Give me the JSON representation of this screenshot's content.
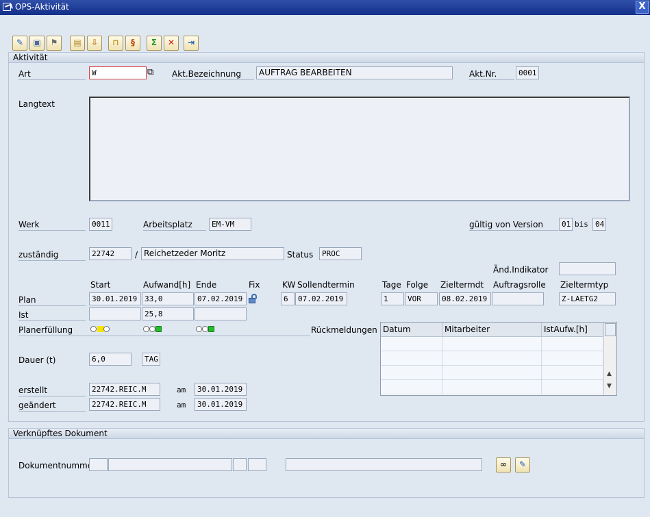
{
  "window": {
    "title": "OPS-Aktivität",
    "close_glyph": "X"
  },
  "toolbar": [
    {
      "name": "edit-pencil-icon",
      "glyph": "✎",
      "color": "#1f5fc4"
    },
    {
      "name": "save-icon",
      "glyph": "▣",
      "color": "#4a6aa0"
    },
    {
      "name": "flag-icon",
      "glyph": "⚑",
      "color": "#6a6a6a"
    },
    {
      "name": "clipboard-icon",
      "glyph": "▤",
      "color": "#b08a2a"
    },
    {
      "name": "download-icon",
      "glyph": "⇩",
      "color": "#c08020"
    },
    {
      "name": "lock-icon",
      "glyph": "⊓",
      "color": "#c09a20"
    },
    {
      "name": "scroll-icon",
      "glyph": "§",
      "color": "#c04a10"
    },
    {
      "name": "sum-icon",
      "glyph": "Σ",
      "color": "#2a9a2a"
    },
    {
      "name": "delete-icon",
      "glyph": "✕",
      "color": "#d02020"
    },
    {
      "name": "export-icon",
      "glyph": "⇥",
      "color": "#2a60b0"
    }
  ],
  "aktivitaet": {
    "frame_title": "Aktivität",
    "art_label": "Art",
    "art_value": "W",
    "copy_glyph": "⧉",
    "bez_label": "Akt.Bezeichnung",
    "bez_value": "AUFTRAG BEARBEITEN",
    "nr_label": "Akt.Nr.",
    "nr_value": "0001",
    "langtext_label": "Langtext",
    "werk_label": "Werk",
    "werk_value": "0011",
    "arbeitsplatz_label": "Arbeitsplatz",
    "arbeitsplatz_value": "EM-VM",
    "version_label": "gültig von Version",
    "version_from": "01",
    "bis_label": "bis",
    "version_to": "04",
    "zustaendig_label": "zuständig",
    "zustaendig_value": "22742",
    "slash": "/",
    "zustaendig_name": "Reichetzeder Moritz",
    "status_label": "Status",
    "status_value": "PROC",
    "aend_label": "Änd.Indikator",
    "aend_value": "",
    "headers": {
      "start": "Start",
      "aufwand": "Aufwand[h]",
      "ende": "Ende",
      "fix": "Fix",
      "kw": "KW",
      "sollend": "Sollendtermin",
      "tage": "Tage",
      "folge": "Folge",
      "zieltermdt": "Zieltermdt",
      "auftragsrolle": "Auftragsrolle",
      "zieltermtyp": "Zieltermtyp"
    },
    "plan": {
      "label": "Plan",
      "start": "30.01.2019",
      "aufwand": "33,0",
      "ende": "07.02.2019",
      "kw": "6",
      "sollend": "07.02.2019",
      "tage": "1",
      "folge": "VOR",
      "zieltermdt": "08.02.2019",
      "auftragsrolle": "",
      "zieltermtyp": "Z-LAETG2"
    },
    "ist": {
      "label": "Ist",
      "start": "",
      "aufwand": "25,8",
      "ende": ""
    },
    "planerfuellung_label": "Planerfüllung",
    "rueckmeldungen": {
      "label": "Rückmeldungen",
      "columns": [
        "Datum",
        "Mitarbeiter",
        "IstAufw.[h]"
      ],
      "rows": [
        [
          "",
          "",
          ""
        ],
        [
          "",
          "",
          ""
        ],
        [
          "",
          "",
          ""
        ],
        [
          "",
          "",
          ""
        ]
      ],
      "scroll_up": "▲",
      "scroll_down": "▼"
    },
    "dauer_label": "Dauer (t)",
    "dauer_value": "6,0",
    "dauer_unit": "TAG",
    "erstellt_label": "erstellt",
    "erstellt_value": "22742.REIC.M",
    "am_label": "am",
    "erstellt_am": "30.01.2019",
    "geaendert_label": "geändert",
    "geaendert_value": "22742.REIC.M",
    "geaendert_am": "30.01.2019"
  },
  "dokument": {
    "frame_title": "Verknüpftes Dokument",
    "nummer_label": "Dokumentnummer",
    "fields": [
      "",
      "",
      "",
      "",
      ""
    ],
    "glasses_glyph": "∞",
    "edit_glyph": "✎"
  }
}
